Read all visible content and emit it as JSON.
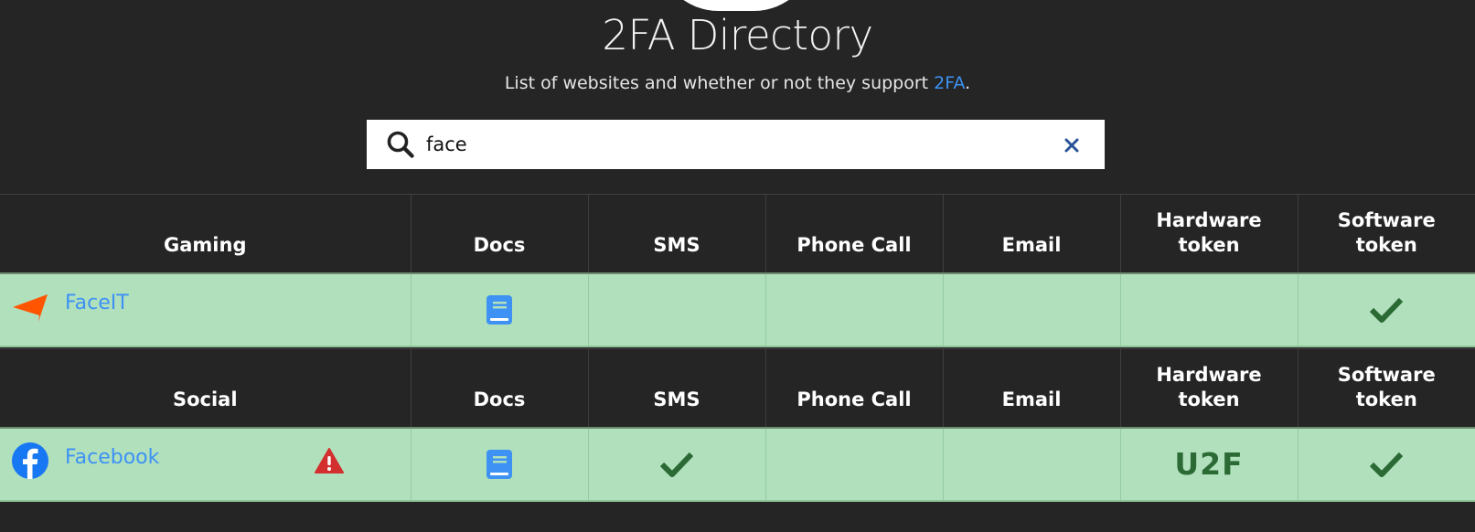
{
  "header": {
    "title": "2FA Directory",
    "subtitle_prefix": "List of websites and whether or not they support ",
    "subtitle_link": "2FA",
    "subtitle_suffix": "."
  },
  "search": {
    "value": "face",
    "clear_icon": "close-icon",
    "search_icon": "search-icon"
  },
  "colors": {
    "background": "#252525",
    "row_green": "#b1e0bd",
    "link_blue": "#3d92f3",
    "check_green": "#2b6a34",
    "warning_red": "#d32f2f",
    "faceit_orange": "#ff5500",
    "facebook_blue": "#1877f2"
  },
  "columns": [
    "Docs",
    "SMS",
    "Phone Call",
    "Email",
    "Hardware token",
    "Software token"
  ],
  "categories": [
    {
      "name": "Gaming",
      "columns": {
        "docs": "Docs",
        "sms": "SMS",
        "phone": "Phone Call",
        "email": "Email",
        "hardware_1": "Hardware",
        "hardware_2": "token",
        "software_1": "Software",
        "software_2": "token"
      },
      "sites": [
        {
          "name": "FaceIT",
          "logo": "faceit-logo",
          "docs": true,
          "sms": false,
          "phone": false,
          "email": false,
          "hardware": "",
          "software": true
        }
      ]
    },
    {
      "name": "Social",
      "columns": {
        "docs": "Docs",
        "sms": "SMS",
        "phone": "Phone Call",
        "email": "Email",
        "hardware_1": "Hardware",
        "hardware_2": "token",
        "software_1": "Software",
        "software_2": "token"
      },
      "sites": [
        {
          "name": "Facebook",
          "logo": "facebook-logo",
          "warning": true,
          "docs": true,
          "sms": true,
          "phone": false,
          "email": false,
          "hardware": "U2F",
          "software": true
        }
      ]
    }
  ]
}
